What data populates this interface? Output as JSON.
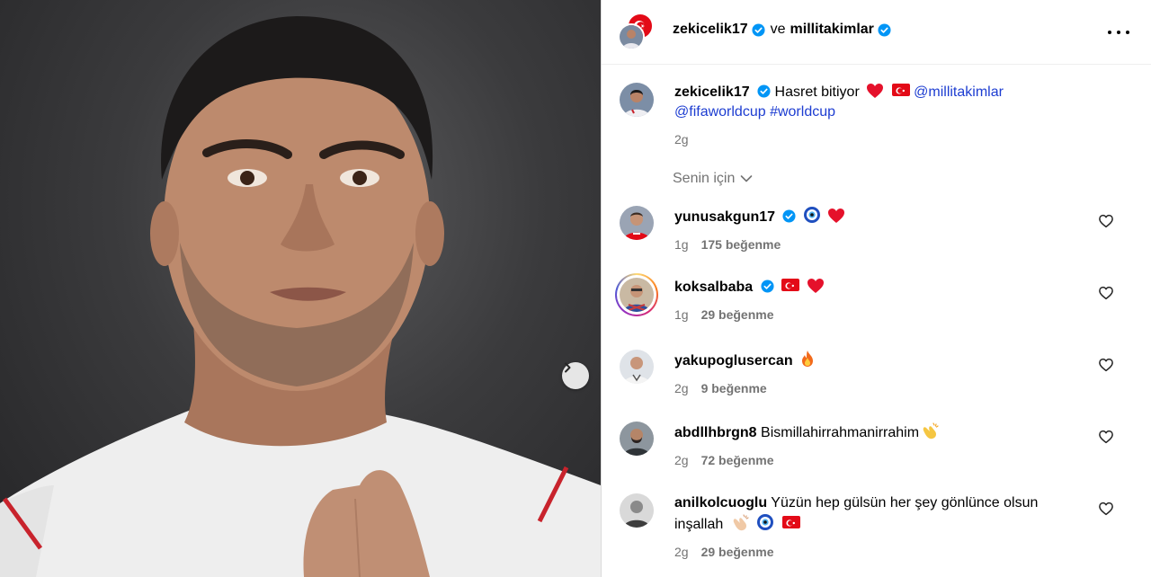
{
  "header": {
    "user1": "zekicelik17",
    "and_text": "ve",
    "user2": "millitakimlar",
    "more_label": "Daha fazla seçenek"
  },
  "caption": {
    "username": "zekicelik17",
    "text": "Hasret bitiyor",
    "mention": "@millitakimlar",
    "mention2": "@fifaworldcup",
    "hashtag": "#worldcup",
    "time": "2g"
  },
  "for_you_label": "Senin için",
  "comments": [
    {
      "username": "yunusakgun17",
      "verified": true,
      "text": "",
      "time": "1g",
      "likes": "175 beğenme"
    },
    {
      "username": "koksalbaba",
      "verified": true,
      "text": "",
      "time": "1g",
      "likes": "29 beğenme"
    },
    {
      "username": "yakupoglusercan",
      "verified": false,
      "text": "",
      "time": "2g",
      "likes": "9 beğenme"
    },
    {
      "username": "abdllhbrgn8",
      "verified": false,
      "text": "Bismillahirrahmanirrahim",
      "time": "2g",
      "likes": "72 beğenme"
    },
    {
      "username": "anilkolcuoglu",
      "verified": false,
      "text": "Yüzün hep gülsün her şey gönlünce olsun",
      "text2": "inşallah",
      "time": "2g",
      "likes": "29 beğenme"
    }
  ],
  "colors": {
    "link": "#1d3dd1",
    "verified": "#0095f6",
    "muted": "#737373",
    "flag_red": "#e30a17"
  },
  "icons": [
    "verified-badge-icon",
    "more-options-icon",
    "chevron-down-icon",
    "heart-outline-icon",
    "next-arrow-icon",
    "red-heart-emoji",
    "turkish-flag-emoji",
    "evil-eye-emoji",
    "fire-emoji",
    "clapping-hands-emoji"
  ]
}
